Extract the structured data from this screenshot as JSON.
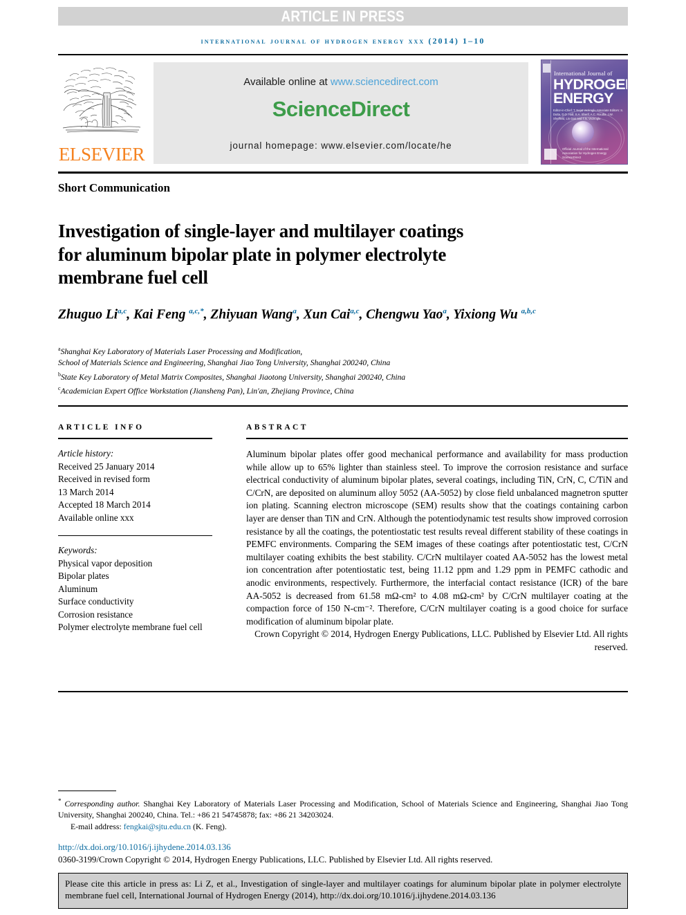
{
  "banner": {
    "article_in_press": "ARTICLE IN PRESS"
  },
  "running_head": "INTERNATIONAL JOURNAL OF HYDROGEN ENERGY XXX (2014) 1–10",
  "masthead": {
    "publisher_logo_word": "ELSEVIER",
    "available_prefix": "Available online at ",
    "available_url": "www.sciencedirect.com",
    "sciencedirect_logo": "ScienceDirect",
    "journal_homepage": "journal homepage: www.elsevier.com/locate/he",
    "cover": {
      "title_small": "International Journal of",
      "title_line1": "HYDROGEN",
      "title_line2": "ENERGY",
      "editors": "Editor-in-Chief: T. Nejat Veziroglu   Associate Editors: S. Dutta, D.O. Hall, S.A. Sherif, A.C. Roudia, J.W. Sheffield, Lin Gao and T.N. Veziroglu",
      "footer": "Official Journal of the International Association for Hydrogen Energy   ScienceDirect"
    }
  },
  "article": {
    "type": "Short Communication",
    "title": "Investigation of single-layer and multilayer coatings for aluminum bipolar plate in polymer electrolyte membrane fuel cell",
    "authors": [
      {
        "name": "Zhuguo Li",
        "sup": "a,c",
        "sep": ", "
      },
      {
        "name": "Kai Feng ",
        "sup": "a,c,*",
        "sep": ", "
      },
      {
        "name": "Zhiyuan Wang",
        "sup": "a",
        "sep": ", "
      },
      {
        "name": "Xun Cai",
        "sup": "a,c",
        "sep": ", "
      },
      {
        "name": "Chengwu Yao",
        "sup": "a",
        "sep": ", "
      },
      {
        "name": "Yixiong Wu ",
        "sup": "a,b,c",
        "sep": ""
      }
    ],
    "affiliations": [
      {
        "mark": "a",
        "lines": [
          "Shanghai Key Laboratory of Materials Laser Processing and Modification,",
          "School of Materials Science and Engineering, Shanghai Jiao Tong University, Shanghai 200240, China"
        ]
      },
      {
        "mark": "b",
        "lines": [
          "State Key Laboratory of Metal Matrix Composites, Shanghai Jiaotong University, Shanghai 200240, China"
        ]
      },
      {
        "mark": "c",
        "lines": [
          "Academician Expert Office Workstation (Jiansheng Pan), Lin'an, Zhejiang Province, China"
        ]
      }
    ]
  },
  "article_info": {
    "heading": "ARTICLE INFO",
    "history_label": "Article history:",
    "history": [
      "Received 25 January 2014",
      "Received in revised form",
      "13 March 2014",
      "Accepted 18 March 2014",
      "Available online xxx"
    ],
    "keywords_label": "Keywords:",
    "keywords": [
      "Physical vapor deposition",
      "Bipolar plates",
      "Aluminum",
      "Surface conductivity",
      "Corrosion resistance",
      "Polymer electrolyte membrane fuel cell"
    ]
  },
  "abstract": {
    "heading": "ABSTRACT",
    "body": "Aluminum bipolar plates offer good mechanical performance and availability for mass production while allow up to 65% lighter than stainless steel. To improve the corrosion resistance and surface electrical conductivity of aluminum bipolar plates, several coatings, including TiN, CrN, C, C/TiN and C/CrN, are deposited on aluminum alloy 5052 (AA-5052) by close field unbalanced magnetron sputter ion plating. Scanning electron microscope (SEM) results show that the coatings containing carbon layer are denser than TiN and CrN. Although the potentiodynamic test results show improved corrosion resistance by all the coatings, the potentiostatic test results reveal different stability of these coatings in PEMFC environments. Comparing the SEM images of these coatings after potentiostatic test, C/CrN multilayer coating exhibits the best stability. C/CrN multilayer coated AA-5052 has the lowest metal ion concentration after potentiostatic test, being 11.12 ppm and 1.29 ppm in PEMFC cathodic and anodic environments, respectively. Furthermore, the interfacial contact resistance (ICR) of the bare AA-5052 is decreased from 61.58 mΩ-cm² to 4.08 mΩ-cm² by C/CrN multilayer coating at the compaction force of 150 N-cm⁻². Therefore, C/CrN multilayer coating is a good choice for surface modification of aluminum bipolar plate.",
    "copyright": "Crown Copyright © 2014, Hydrogen Energy Publications, LLC. Published by Elsevier Ltd. All rights reserved."
  },
  "footnotes": {
    "corresponding_label": "Corresponding author.",
    "corresponding_text": " Shanghai Key Laboratory of Materials Laser Processing and Modification, School of Materials Science and Engineering, Shanghai Jiao Tong University, Shanghai 200240, China. Tel.: +86 21 54745878; fax: +86 21 34203024.",
    "email_label": "E-mail address: ",
    "email": "fengkai@sjtu.edu.cn",
    "email_suffix": " (K. Feng)."
  },
  "doi": "http://dx.doi.org/10.1016/j.ijhydene.2014.03.136",
  "issn_copyright": "0360-3199/Crown Copyright © 2014, Hydrogen Energy Publications, LLC. Published by Elsevier Ltd. All rights reserved.",
  "cite_box": "Please cite this article in press as: Li Z, et al., Investigation of single-layer and multilayer coatings for aluminum bipolar plate in polymer electrolyte membrane fuel cell, International Journal of Hydrogen Energy (2014), http://dx.doi.org/10.1016/j.ijhydene.2014.03.136",
  "colors": {
    "banner_gray": "#d2d2d2",
    "link_blue": "#0c6ca0",
    "sciencedirect_green": "#3d9c4a",
    "elsevier_orange": "#f58220",
    "sd_banner_bg": "#e7e7e7",
    "cite_box_bg": "#cfcfcf"
  }
}
